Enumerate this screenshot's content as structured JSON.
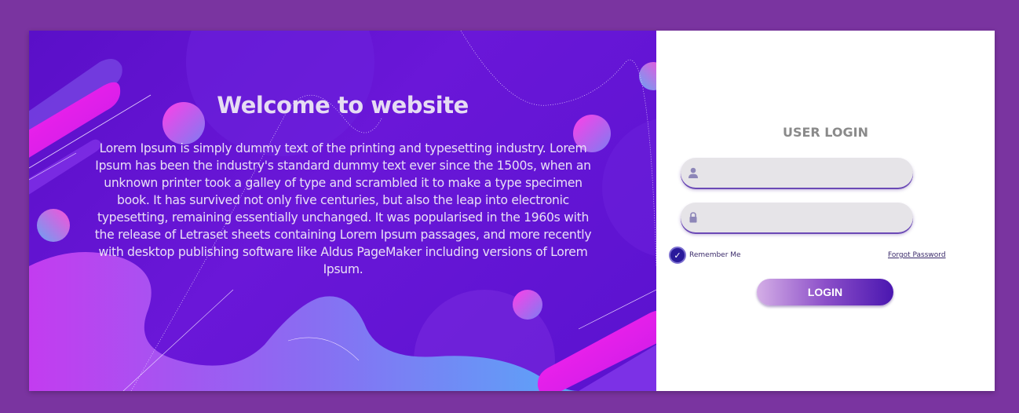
{
  "hero": {
    "title": "Welcome to website",
    "body": "Lorem Ipsum is simply dummy text of the printing and typesetting industry. Lorem Ipsum has been the industry's standard dummy text ever since the 1500s, when an unknown printer took a galley of type and scrambled it to make a type specimen book. It has survived not only five centuries, but also the leap into electronic typesetting, remaining essentially unchanged. It was popularised in the 1960s with the release of Letraset sheets containing Lorem Ipsum passages, and more recently with desktop publishing software like Aldus PageMaker including versions of Lorem Ipsum."
  },
  "login": {
    "title": "USER LOGIN",
    "username": {
      "value": "",
      "icon": "user-icon"
    },
    "password": {
      "value": "",
      "icon": "lock-icon"
    },
    "remember_label": "Remember Me",
    "remember_checked": true,
    "forgot_label": "Forgot Password",
    "button_label": "LOGIN"
  },
  "colors": {
    "page_bg": "#7a34a0",
    "hero_bg": "#5a0fc8",
    "accent_pink": "#f21cf0",
    "accent_blue": "#58a8f8",
    "button_dark": "#4a16b0"
  }
}
